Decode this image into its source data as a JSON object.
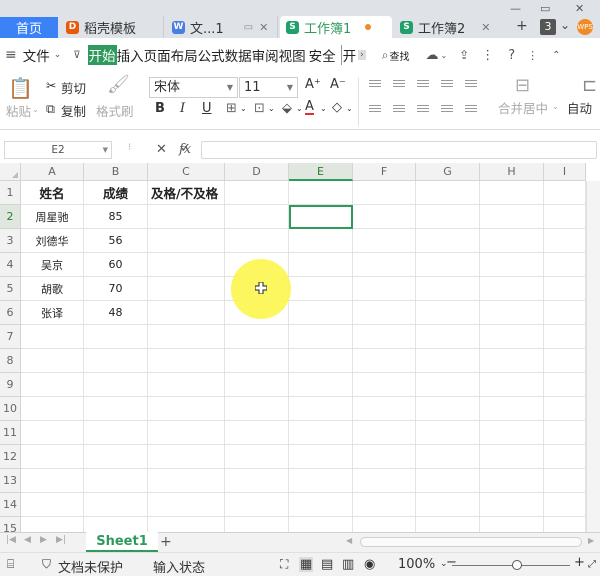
{
  "tabs": {
    "home": "首页",
    "docs": [
      {
        "label": "稻壳模板",
        "icon": "wps-docer-icon"
      },
      {
        "label": "文...1",
        "icon": "wps-writer-icon"
      },
      {
        "label": "工作簿1",
        "icon": "wps-sheet-icon"
      },
      {
        "label": "工作簿2",
        "icon": "wps-sheet-icon"
      }
    ],
    "badge": "3"
  },
  "menu": {
    "file": "文件",
    "items": [
      "开始",
      "插入",
      "页面布局",
      "公式",
      "数据",
      "审阅",
      "视图",
      "安全",
      "开"
    ],
    "search": "查找"
  },
  "ribbon": {
    "paste": "粘贴",
    "cut": "剪切",
    "copy": "复制",
    "format_painter": "格式刷",
    "font_name": "宋体",
    "font_size": "11",
    "merge": "合并居中",
    "wrap": "自动"
  },
  "formula_bar": {
    "cell_ref": "E2",
    "fx": "fx"
  },
  "sheet": {
    "columns": [
      "A",
      "B",
      "C",
      "D",
      "E",
      "F",
      "G",
      "H",
      "I"
    ],
    "rows": [
      "1",
      "2",
      "3",
      "4",
      "5",
      "6",
      "7",
      "8",
      "9",
      "10",
      "11",
      "12",
      "13",
      "14",
      "15"
    ],
    "headers": [
      "姓名",
      "成绩",
      "及格/不及格"
    ],
    "data": [
      [
        "周星驰",
        "85"
      ],
      [
        "刘德华",
        "56"
      ],
      [
        "吴京",
        "60"
      ],
      [
        "胡歌",
        "70"
      ],
      [
        "张译",
        "48"
      ]
    ],
    "tab_name": "Sheet1"
  },
  "status": {
    "protect": "文档未保护",
    "input": "输入状态",
    "zoom": "100%"
  },
  "colors": {
    "accent_green": "#2e9a5b",
    "home_blue": "#3b82f6",
    "cursor_yellow": "#fcf650"
  }
}
